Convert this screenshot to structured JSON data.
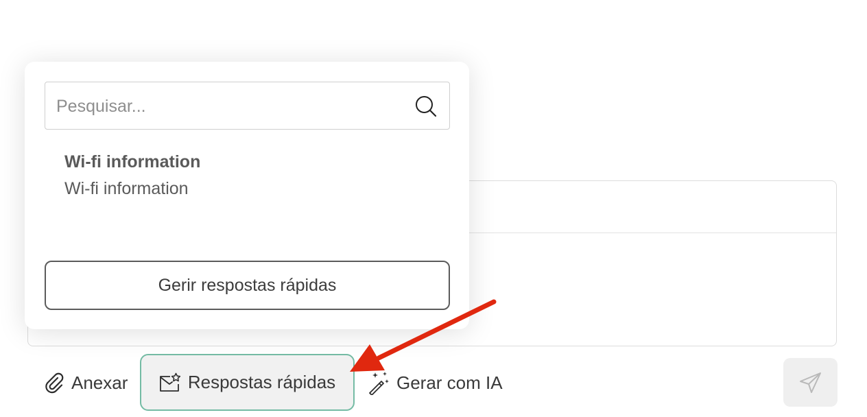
{
  "popover": {
    "search": {
      "placeholder": "Pesquisar..."
    },
    "items": [
      {
        "title": "Wi-fi information",
        "body": "Wi-fi information"
      }
    ],
    "manage_label": "Gerir respostas rápidas"
  },
  "toolbar": {
    "attach_label": "Anexar",
    "quick_replies_label": "Respostas rápidas",
    "generate_ai_label": "Gerar com IA"
  },
  "colors": {
    "accent_border": "#74bba4",
    "annotation_arrow": "#e0280f",
    "send_button_bg": "#efefef"
  },
  "icons": {
    "search": "search-icon",
    "attach": "paperclip-icon",
    "quick_replies": "envelope-star-icon",
    "ai": "magic-wand-icon",
    "send": "paper-plane-icon"
  }
}
